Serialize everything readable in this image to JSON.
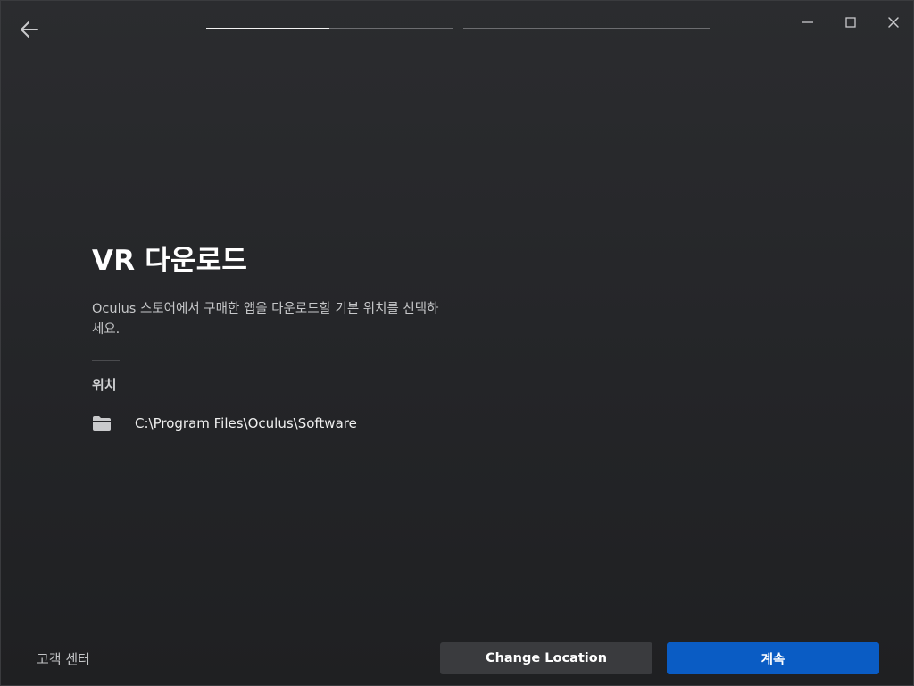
{
  "header": {
    "progress": [
      {
        "step": 1,
        "fraction": 0.5
      },
      {
        "step": 2,
        "fraction": 0.0
      }
    ]
  },
  "icons": {
    "back": "back-arrow-icon",
    "minimize": "minimize-icon",
    "maximize": "maximize-icon",
    "close": "close-icon",
    "folder": "folder-icon"
  },
  "main": {
    "title": "VR 다운로드",
    "description": "Oculus 스토어에서 구매한 앱을 다운로드할 기본 위치를 선택하세요.",
    "location_label": "위치",
    "location_path": "C:\\Program Files\\Oculus\\Software"
  },
  "footer": {
    "help_link": "고객 센터",
    "change_location_label": "Change Location",
    "continue_label": "계속"
  },
  "colors": {
    "background": "#242528",
    "primary_button": "#0a5cc4",
    "secondary_button": "#3a3b3e",
    "progress_fill": "#f2f2f2",
    "progress_track": "#6c6d70"
  }
}
